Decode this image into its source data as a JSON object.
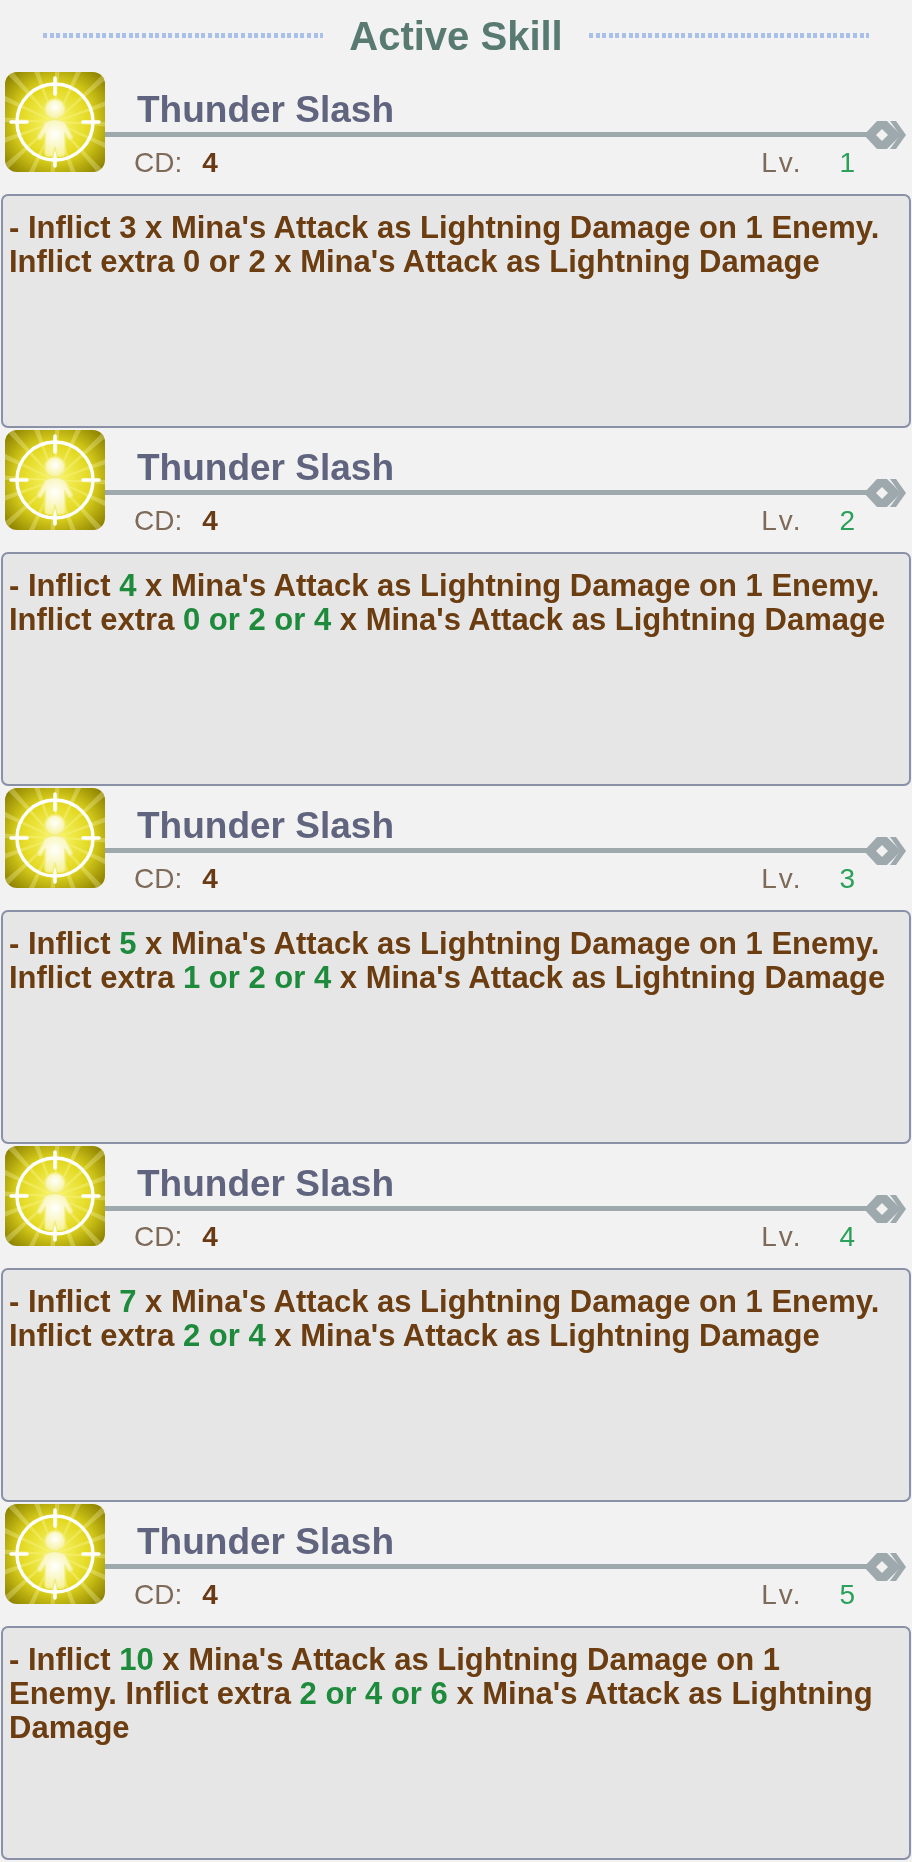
{
  "header": {
    "title": "Active Skill"
  },
  "skills": [
    {
      "name": "Thunder Slash",
      "cd_label": "CD:",
      "cd": "4",
      "lv_label": "Lv.",
      "lv": "1",
      "description": [
        {
          "text": "- Inflict 3 x Mina's Attack as Lightning Damage on 1 Enemy. Inflict extra 0 or 2 x Mina's Attack as Lightning Damage",
          "highlight": false
        }
      ]
    },
    {
      "name": "Thunder Slash",
      "cd_label": "CD:",
      "cd": "4",
      "lv_label": "Lv.",
      "lv": "2",
      "description": [
        {
          "text": "- Inflict ",
          "highlight": false
        },
        {
          "text": "4",
          "highlight": true
        },
        {
          "text": " x Mina's Attack as Lightning Damage on 1 Enemy. Inflict extra ",
          "highlight": false
        },
        {
          "text": "0 or 2 or 4",
          "highlight": true
        },
        {
          "text": " x Mina's Attack as Lightning Damage",
          "highlight": false
        }
      ]
    },
    {
      "name": "Thunder Slash",
      "cd_label": "CD:",
      "cd": "4",
      "lv_label": "Lv.",
      "lv": "3",
      "description": [
        {
          "text": "- Inflict ",
          "highlight": false
        },
        {
          "text": "5",
          "highlight": true
        },
        {
          "text": " x Mina's Attack as Lightning Damage on 1 Enemy. Inflict extra ",
          "highlight": false
        },
        {
          "text": "1 or 2 or 4",
          "highlight": true
        },
        {
          "text": " x Mina's Attack as Lightning Damage",
          "highlight": false
        }
      ]
    },
    {
      "name": "Thunder Slash",
      "cd_label": "CD:",
      "cd": "4",
      "lv_label": "Lv.",
      "lv": "4",
      "description": [
        {
          "text": "- Inflict ",
          "highlight": false
        },
        {
          "text": "7",
          "highlight": true
        },
        {
          "text": " x Mina's Attack as Lightning Damage on 1 Enemy. Inflict extra ",
          "highlight": false
        },
        {
          "text": "2 or 4",
          "highlight": true
        },
        {
          "text": " x Mina's Attack as Lightning Damage",
          "highlight": false
        }
      ]
    },
    {
      "name": "Thunder Slash",
      "cd_label": "CD:",
      "cd": "4",
      "lv_label": "Lv.",
      "lv": "5",
      "description": [
        {
          "text": "- Inflict ",
          "highlight": false
        },
        {
          "text": "10",
          "highlight": true
        },
        {
          "text": " x Mina's Attack as Lightning Damage on 1 Enemy. Inflict extra ",
          "highlight": false
        },
        {
          "text": "2 or 4 or 6",
          "highlight": true
        },
        {
          "text": " x Mina's Attack as Lightning Damage",
          "highlight": false
        }
      ]
    }
  ]
}
